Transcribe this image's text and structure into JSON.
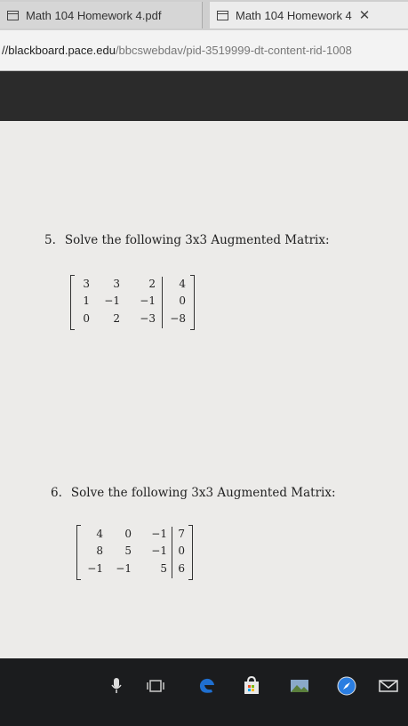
{
  "browser": {
    "tabs": [
      {
        "title": "Math 104 Homework 4.pdf",
        "active": false
      },
      {
        "title": "Math 104 Homework 4",
        "active": true,
        "close_glyph": "✕"
      }
    ],
    "address": {
      "prefix": "//",
      "host": "blackboard.pace.edu",
      "path": "/bbcswebdav/pid-3519999-dt-content-rid-1008"
    }
  },
  "document": {
    "problems": [
      {
        "number": "5.",
        "text": "Solve the following 3x3 Augmented Matrix:",
        "matrix": [
          [
            "3",
            "3",
            "2",
            "4"
          ],
          [
            "1",
            "−1",
            "−1",
            "0"
          ],
          [
            "0",
            "2",
            "−3",
            "−8"
          ]
        ]
      },
      {
        "number": "6.",
        "text": "Solve the following 3x3 Augmented Matrix:",
        "matrix": [
          [
            "4",
            "0",
            "−1",
            "7"
          ],
          [
            "8",
            "5",
            "−1",
            "0"
          ],
          [
            "−1",
            "−1",
            "5",
            "6"
          ]
        ]
      }
    ]
  },
  "taskbar": {
    "icons": [
      "microphone-icon",
      "task-view-icon",
      "edge-browser-icon",
      "store-icon",
      "photos-icon",
      "safari-compass-icon",
      "mail-icon"
    ],
    "colors": {
      "edge": "#1f6fd0",
      "store": "#e8e8e8",
      "compass": "#2a7de1"
    }
  }
}
